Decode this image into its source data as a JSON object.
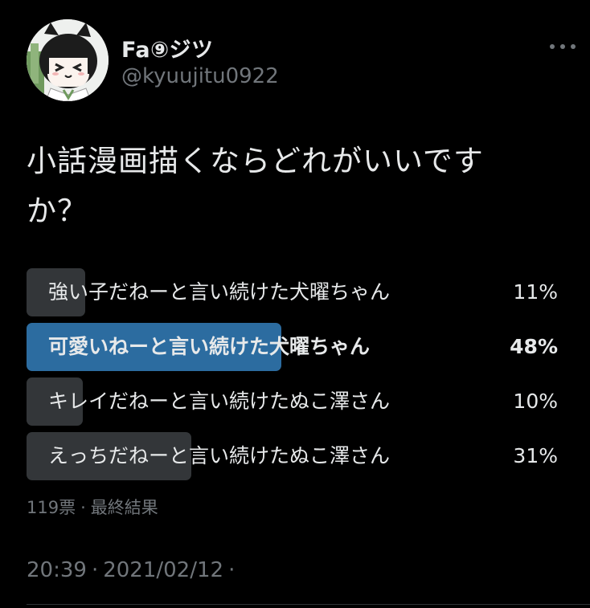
{
  "user": {
    "display_name": "Fa⑨ジツ",
    "handle": "@kyuujitu0922"
  },
  "tweet": {
    "text": "小話漫画描くならどれがいいですか？"
  },
  "poll": {
    "options": [
      {
        "label": "強い子だねーと言い続けた犬曜ちゃん",
        "percent_label": "11%",
        "percent": 11,
        "winner": false
      },
      {
        "label": "可愛いねーと言い続けた犬曜ちゃん",
        "percent_label": "48%",
        "percent": 48,
        "winner": true
      },
      {
        "label": "キレイだねーと言い続けたぬこ澤さん",
        "percent_label": "10%",
        "percent": 10,
        "winner": false
      },
      {
        "label": "えっちだねーと言い続けたぬこ澤さん",
        "percent_label": "31%",
        "percent": 31,
        "winner": false
      }
    ],
    "votes": "119票",
    "status": "最終結果"
  },
  "meta": {
    "time": "20:39",
    "date": "2021/02/12"
  },
  "colors": {
    "background": "#000000",
    "text": "#e7e9ea",
    "muted": "#71767b",
    "poll_bar": "#333639",
    "poll_bar_winner": "#2c6ca0"
  },
  "icons": {
    "more": "more-horizontal-icon"
  }
}
